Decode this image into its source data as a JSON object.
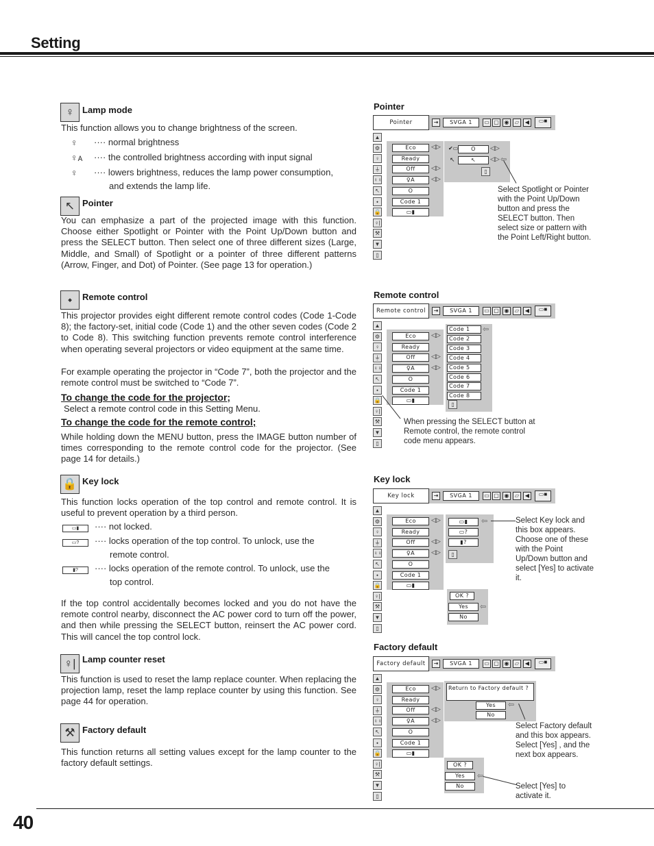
{
  "header": {
    "title": "Setting"
  },
  "footer": {
    "page_number": "40"
  },
  "left": {
    "lamp_mode": {
      "icon": "lamp-mode-icon",
      "title": "Lamp mode",
      "intro": "This function allows you to change brightness of the screen.",
      "items": [
        {
          "icon": "normal-lamp-icon",
          "text": "···· normal brightness"
        },
        {
          "icon": "auto-lamp-icon",
          "text": "···· the controlled brightness according with input signal"
        },
        {
          "icon": "eco-lamp-icon",
          "text": "···· lowers brightness, reduces the lamp power consumption,",
          "cont": "and extends the lamp life."
        }
      ]
    },
    "pointer": {
      "icon": "pointer-icon",
      "title": "Pointer",
      "body": "You can emphasize a part of the projected image with this function. Choose either Spotlight or Pointer with the Point Up/Down button and press the SELECT button.  Then select one of three different sizes (Large, Middle, and Small) of Spotlight or a pointer of three different patterns (Arrow, Finger, and Dot) of Pointer.  (See page 13 for operation.)"
    },
    "remote_control": {
      "icon": "remote-control-icon",
      "title": "Remote control",
      "body1": "This projector provides eight different remote control codes (Code 1-Code 8); the factory-set, initial code (Code 1) and the other seven codes (Code 2 to Code 8).  This switching function prevents remote control interference when operating several projectors or video equipment at the same time.",
      "body2": "For example operating the projector in “Code 7”,  both the projector and the remote control must be switched to “Code 7”.",
      "sub1_title": "To change the code for the projector;",
      "sub1_body": "Select a remote control code in this Setting Menu.",
      "sub2_title": "To change the code for the remote control;",
      "sub2_body": "While holding down the MENU button, press the IMAGE button number of times corresponding to the remote control code for the projector.  (See page 14 for details.)"
    },
    "key_lock": {
      "icon": "key-lock-icon",
      "title": "Key lock",
      "intro": "This function locks operation of the top control and remote control. It is useful to prevent operation by a third person.",
      "items": [
        {
          "icon": "not-locked-icon",
          "glyph": "▭▮",
          "text": "···· not locked."
        },
        {
          "icon": "top-control-locked-icon",
          "glyph": "▭?",
          "text": "···· locks operation of the top control.  To unlock, use the",
          "cont": "remote control."
        },
        {
          "icon": "remote-locked-icon",
          "glyph": "▮?",
          "text": "···· locks operation of the remote control.  To unlock, use the",
          "cont": "top control."
        }
      ],
      "note": "If the top control accidentally becomes locked and you do not have the remote control nearby, disconnect the AC power cord to turn off the power, and then while pressing the SELECT button, reinsert the AC power cord.  This will cancel the top control lock."
    },
    "lamp_counter_reset": {
      "icon": "lamp-counter-reset-icon",
      "title": "Lamp counter reset",
      "body": "This function is used to reset the lamp replace counter.  When replacing the projection lamp, reset the lamp replace counter by using this function.  See page 44 for operation."
    },
    "factory_default": {
      "icon": "factory-default-icon",
      "title": "Factory default",
      "body": "This function returns all setting values except for the lamp counter to the factory default settings."
    }
  },
  "osd_common": {
    "svga": "SVGA 1",
    "fields": [
      "Eco",
      "Ready",
      "Off",
      "♀A",
      "O",
      "Code 1",
      "▭▮"
    ],
    "side_icons": [
      "▲",
      "⚙",
      "♀",
      "⏚",
      "♀♀",
      "↖",
      "⬩",
      "🔒",
      "♀|",
      "⚒",
      "▼",
      "▯"
    ]
  },
  "diagrams": {
    "pointer": {
      "title": "Pointer",
      "menu_name": "Pointer",
      "sub_fields": [
        "O",
        "↖"
      ],
      "callout": "Select Spotlight or Pointer with the Point Up/Down button and press the SELECT button.  Then select size or pattern with the Point Left/Right button."
    },
    "remote_control": {
      "title": "Remote control",
      "menu_name": "Remote control",
      "codes": [
        "Code 1",
        "Code 2",
        "Code 3",
        "Code 4",
        "Code 5",
        "Code 6",
        "Code 7",
        "Code 8"
      ],
      "callout": "When pressing the SELECT button at Remote control, the remote control code menu appears."
    },
    "key_lock": {
      "title": "Key lock",
      "menu_name": "Key lock",
      "options": [
        "▭▮",
        "▭?",
        "▮?"
      ],
      "confirm": [
        "OK ?",
        "Yes",
        "No"
      ],
      "callout": "Select Key lock and this box appears.  Choose one of these with the Point Up/Down button and select [Yes] to activate it."
    },
    "factory_default": {
      "title": "Factory default",
      "menu_name": "Factory default",
      "question": "Return to Factory default ?",
      "answers": [
        "Yes",
        "No"
      ],
      "confirm": [
        "OK ?",
        "Yes",
        "No"
      ],
      "callout1": "Select Factory default and this box appears.  Select [Yes] , and the next box appears.",
      "callout2": "Select [Yes] to activate it."
    }
  }
}
